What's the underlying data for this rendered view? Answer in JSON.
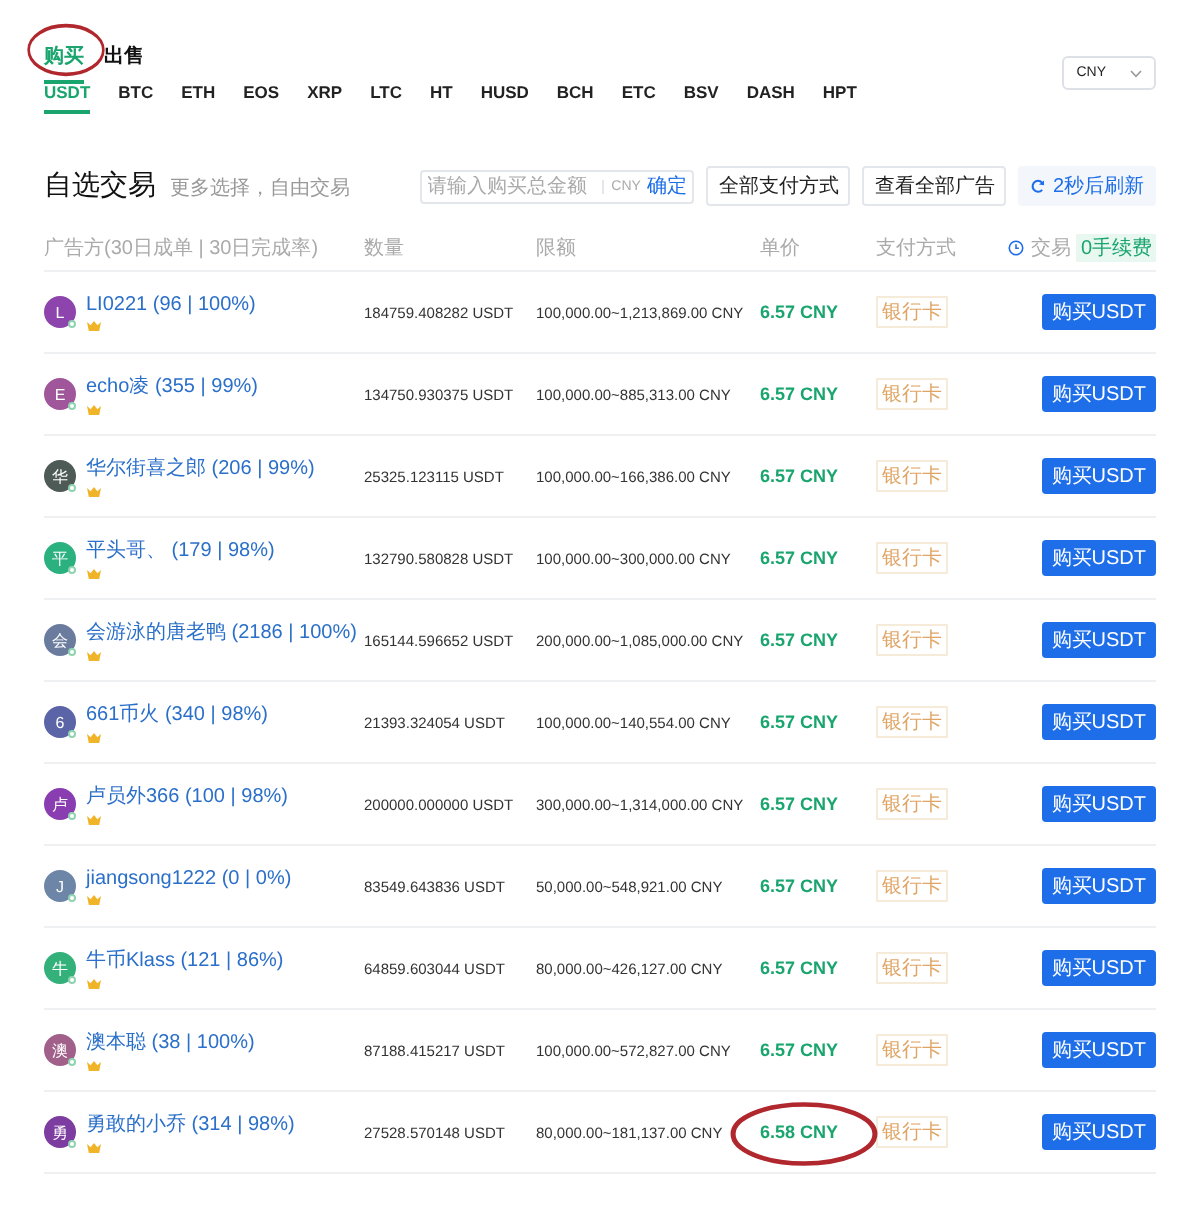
{
  "order_tabs": [
    {
      "label": "购买",
      "selected": true,
      "circled": true
    },
    {
      "label": "出售",
      "selected": false,
      "circled": false
    }
  ],
  "coin_tabs": [
    {
      "label": "USDT",
      "selected": true
    },
    {
      "label": "BTC",
      "selected": false
    },
    {
      "label": "ETH",
      "selected": false
    },
    {
      "label": "EOS",
      "selected": false
    },
    {
      "label": "XRP",
      "selected": false
    },
    {
      "label": "LTC",
      "selected": false
    },
    {
      "label": "HT",
      "selected": false
    },
    {
      "label": "HUSD",
      "selected": false
    },
    {
      "label": "BCH",
      "selected": false
    },
    {
      "label": "ETC",
      "selected": false
    },
    {
      "label": "BSV",
      "selected": false
    },
    {
      "label": "DASH",
      "selected": false
    },
    {
      "label": "HPT",
      "selected": false
    }
  ],
  "currency_select": {
    "value": "CNY"
  },
  "section": {
    "title": "自选交易",
    "subtitle": "更多选择，自由交易"
  },
  "amount_field": {
    "placeholder": "请输入购买总金额",
    "unit": "CNY",
    "confirm": "确定"
  },
  "payment_filter": "全部支付方式",
  "view_all": "查看全部广告",
  "refresh": "2秒后刷新",
  "table": {
    "columns": [
      "广告方(30日成单 | 30日完成率)",
      "数量",
      "限额",
      "单价",
      "支付方式",
      "交易"
    ],
    "fee_badge": "0手续费",
    "rows": [
      {
        "avatar": "L",
        "color": "#8e44ad",
        "name": "LI0221 (96 | 100%)",
        "quantity": "184759.408282 USDT",
        "limit": "100,000.00~1,213,869.00 CNY",
        "price": "6.57 CNY",
        "price_circled": false,
        "payment": "银行卡",
        "action": "购买USDT"
      },
      {
        "avatar": "E",
        "color": "#a0569a",
        "name": "echo凌 (355 | 99%)",
        "quantity": "134750.930375 USDT",
        "limit": "100,000.00~885,313.00 CNY",
        "price": "6.57 CNY",
        "price_circled": false,
        "payment": "银行卡",
        "action": "购买USDT"
      },
      {
        "avatar": "华",
        "color": "#4d5a55",
        "name": "华尔街喜之郎 (206 | 99%)",
        "quantity": "25325.123115 USDT",
        "limit": "100,000.00~166,386.00 CNY",
        "price": "6.57 CNY",
        "price_circled": false,
        "payment": "银行卡",
        "action": "购买USDT"
      },
      {
        "avatar": "平",
        "color": "#2bb07f",
        "name": "平头哥、 (179 | 98%)",
        "quantity": "132790.580828 USDT",
        "limit": "100,000.00~300,000.00 CNY",
        "price": "6.57 CNY",
        "price_circled": false,
        "payment": "银行卡",
        "action": "购买USDT"
      },
      {
        "avatar": "会",
        "color": "#6b7b9e",
        "name": "会游泳的唐老鸭 (2186 | 100%)",
        "quantity": "165144.596652 USDT",
        "limit": "200,000.00~1,085,000.00 CNY",
        "price": "6.57 CNY",
        "price_circled": false,
        "payment": "银行卡",
        "action": "购买USDT"
      },
      {
        "avatar": "6",
        "color": "#5a64a6",
        "name": "661币火 (340 | 98%)",
        "quantity": "21393.324054 USDT",
        "limit": "100,000.00~140,554.00 CNY",
        "price": "6.57 CNY",
        "price_circled": false,
        "payment": "银行卡",
        "action": "购买USDT"
      },
      {
        "avatar": "卢",
        "color": "#8a3db0",
        "name": "卢员外366 (100 | 98%)",
        "quantity": "200000.000000 USDT",
        "limit": "300,000.00~1,314,000.00 CNY",
        "price": "6.57 CNY",
        "price_circled": false,
        "payment": "银行卡",
        "action": "购买USDT"
      },
      {
        "avatar": "J",
        "color": "#6d86a8",
        "name": "jiangsong1222 (0 | 0%)",
        "quantity": "83549.643836 USDT",
        "limit": "50,000.00~548,921.00 CNY",
        "price": "6.57 CNY",
        "price_circled": false,
        "payment": "银行卡",
        "action": "购买USDT"
      },
      {
        "avatar": "牛",
        "color": "#34b07a",
        "name": "牛币Klass (121 | 86%)",
        "quantity": "64859.603044 USDT",
        "limit": "80,000.00~426,127.00 CNY",
        "price": "6.57 CNY",
        "price_circled": false,
        "payment": "银行卡",
        "action": "购买USDT"
      },
      {
        "avatar": "澳",
        "color": "#a0608a",
        "name": "澳本聪 (38 | 100%)",
        "quantity": "87188.415217 USDT",
        "limit": "100,000.00~572,827.00 CNY",
        "price": "6.57 CNY",
        "price_circled": false,
        "payment": "银行卡",
        "action": "购买USDT"
      },
      {
        "avatar": "勇",
        "color": "#7d3ca0",
        "name": "勇敢的小乔 (314 | 98%)",
        "quantity": "27528.570148 USDT",
        "limit": "80,000.00~181,137.00 CNY",
        "price": "6.58 CNY",
        "price_circled": true,
        "payment": "银行卡",
        "action": "购买USDT"
      }
    ]
  }
}
